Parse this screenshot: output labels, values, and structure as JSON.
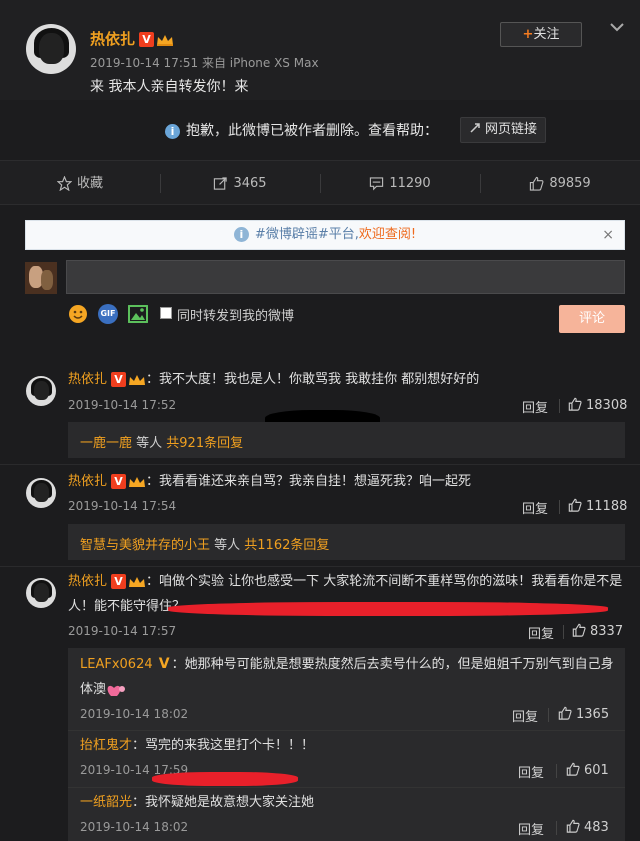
{
  "post": {
    "author": "热依扎",
    "meta": "2019-10-14 17:51 来自 iPhone XS Max",
    "text": "来 我本人亲自转发你！来",
    "follow_label": "关注",
    "follow_plus": "+",
    "badge_v": "V",
    "deleted_msg": "抱歉，此微博已被作者删除。查看帮助：",
    "link_label": "网页链接"
  },
  "actions": {
    "favorite": "收藏",
    "repost_count": "3465",
    "comment_count": "11290",
    "like_count": "89859"
  },
  "rumor": {
    "tag": "#微博辟谣#平台,",
    "welcome": "欢迎查阅!",
    "close": "×"
  },
  "composer": {
    "repost_label": "同时转发到我的微博",
    "submit_label": "评论",
    "gif_label": "GIF"
  },
  "comments": [
    {
      "author": "热依扎",
      "text": "：我不大度！我也是人！你敢骂我 我敢挂你 都别想好好的",
      "time": "2019-10-14 17:52",
      "reply": "回复",
      "likes": "18308",
      "sub_user": "一鹿一鹿",
      "sub_mid": " 等人 ",
      "sub_count": "共921条回复"
    },
    {
      "author": "热依扎",
      "text": "：我看看谁还来亲自骂？我亲自挂！想逼死我？咱一起死",
      "time": "2019-10-14 17:54",
      "reply": "回复",
      "likes": "11188",
      "sub_user": "智慧与美貌并存的小王",
      "sub_mid": " 等人 ",
      "sub_count": "共1162条回复"
    },
    {
      "author": "热依扎",
      "text_line1": "：咱做个实验 让你也感受一下 大家轮流不间断不重样骂你的滋味！我看看你是不是",
      "text_line2": "人！能不能守得住？",
      "time": "2019-10-14 17:57",
      "reply": "回复",
      "likes": "8337"
    }
  ],
  "replies": [
    {
      "author": "LEAFx0624",
      "badge": "V",
      "text_line1": "：她那种号可能就是想要热度然后去卖号什么的，但是姐姐千万别气到自己身",
      "text_line2": "体澳",
      "time": "2019-10-14 18:02",
      "reply": "回复",
      "likes": "1365"
    },
    {
      "author": "抬杠鬼才",
      "text": "：骂完的来我这里打个卡！！！",
      "time": "2019-10-14 17:59",
      "reply": "回复",
      "likes": "601"
    },
    {
      "author": "一纸韶光",
      "text": "：我怀疑她是故意想大家关注她",
      "time": "2019-10-14 18:02",
      "reply": "回复",
      "likes": "483"
    }
  ],
  "colors": {
    "background": "#1c1c1e",
    "name_orange": "#f0a020",
    "redaction_red": "#e8202a",
    "submit_button": "#f6b49a"
  }
}
